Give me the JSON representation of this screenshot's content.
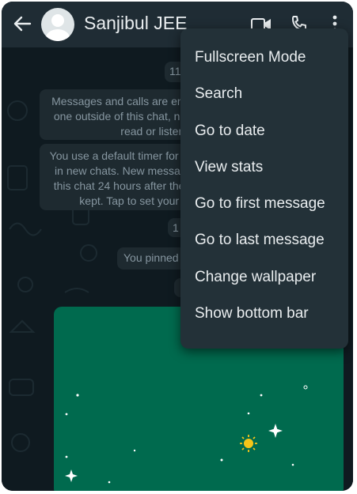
{
  "header": {
    "contact_name": "Sanjibul JEE",
    "icons": [
      "back-arrow-icon",
      "avatar-placeholder",
      "video-call-icon",
      "voice-call-icon",
      "more-options-icon"
    ]
  },
  "chat": {
    "date_label": "11",
    "encryption_notice": "Messages and calls are end-to-end encrypted. No one outside of this chat, not even WhatsApp, can read or listen to them.",
    "timer_notice": "You use a default timer for disappearing messages in new chats. New messages will disappear from this chat 24 hours after they're sent, except when kept. Tap to set your own default timer.",
    "date_label_2": "1",
    "pinned_notice": "You pinned a message",
    "small_label": ""
  },
  "menu": {
    "items": [
      {
        "label": "Fullscreen Mode"
      },
      {
        "label": "Search"
      },
      {
        "label": "Go to date"
      },
      {
        "label": "View stats"
      },
      {
        "label": "Go to first message"
      },
      {
        "label": "Go to last message"
      },
      {
        "label": "Change wallpaper"
      },
      {
        "label": "Show bottom bar"
      }
    ]
  },
  "colors": {
    "header_bg": "#1f2c34",
    "chat_bg": "#0f1a20",
    "menu_bg": "#233138",
    "system_pill_bg": "#1e2a30",
    "wallpaper_card": "#006a4e",
    "text_primary": "#e9edef",
    "text_secondary": "#8696a0"
  }
}
